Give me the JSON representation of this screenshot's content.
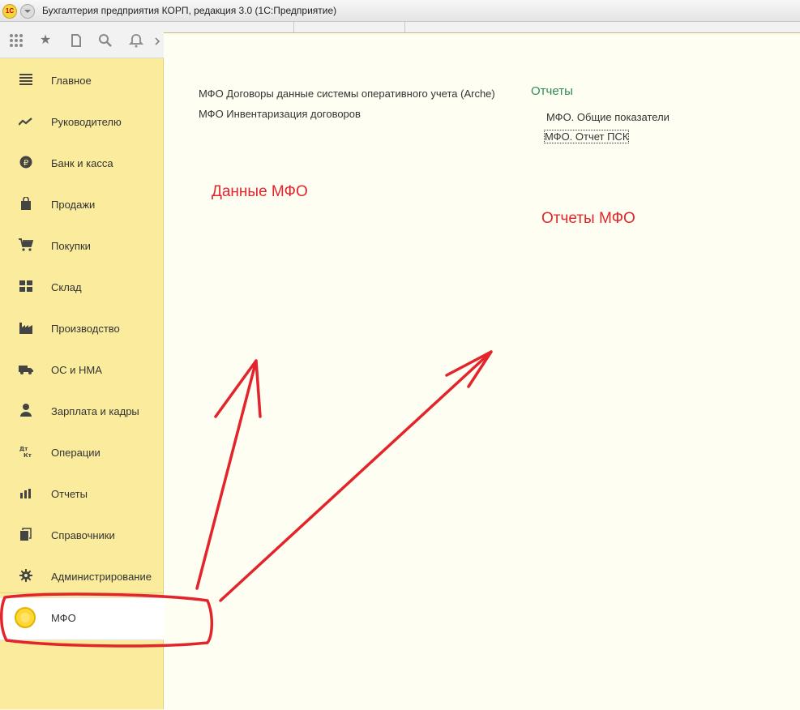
{
  "window": {
    "title": "Бухгалтерия предприятия КОРП, редакция 3.0  (1С:Предприятие)",
    "logo_text": "1С"
  },
  "toolbar": {
    "icons": [
      "apps-grid-icon",
      "star-icon",
      "history-icon",
      "search-icon",
      "bell-icon"
    ]
  },
  "sidebar": {
    "items": [
      {
        "label": "Главное",
        "icon": "menu-lines-icon"
      },
      {
        "label": "Руководителю",
        "icon": "trend-icon"
      },
      {
        "label": "Банк и касса",
        "icon": "ruble-coin-icon"
      },
      {
        "label": "Продажи",
        "icon": "shopping-bag-icon"
      },
      {
        "label": "Покупки",
        "icon": "cart-icon"
      },
      {
        "label": "Склад",
        "icon": "warehouse-grid-icon"
      },
      {
        "label": "Производство",
        "icon": "factory-icon"
      },
      {
        "label": "ОС и НМА",
        "icon": "truck-icon"
      },
      {
        "label": "Зарплата и кадры",
        "icon": "person-icon"
      },
      {
        "label": "Операции",
        "icon": "dt-kt-icon"
      },
      {
        "label": "Отчеты",
        "icon": "bar-chart-icon"
      },
      {
        "label": "Справочники",
        "icon": "books-icon"
      },
      {
        "label": "Администрирование",
        "icon": "gear-icon"
      }
    ],
    "active": {
      "label": "МФО",
      "icon": "coin-icon"
    }
  },
  "content": {
    "links": [
      "МФО Договоры данные системы оперативного учета (Arche)",
      "МФО Инвентаризация договоров"
    ],
    "reports_title": "Отчеты",
    "reports": [
      "МФО. Общие показатели",
      "МФО. Отчет ПСК"
    ]
  },
  "annotations": {
    "data_label": "Данные МФО",
    "reports_label": "Отчеты МФО",
    "color": "#e2252c"
  }
}
